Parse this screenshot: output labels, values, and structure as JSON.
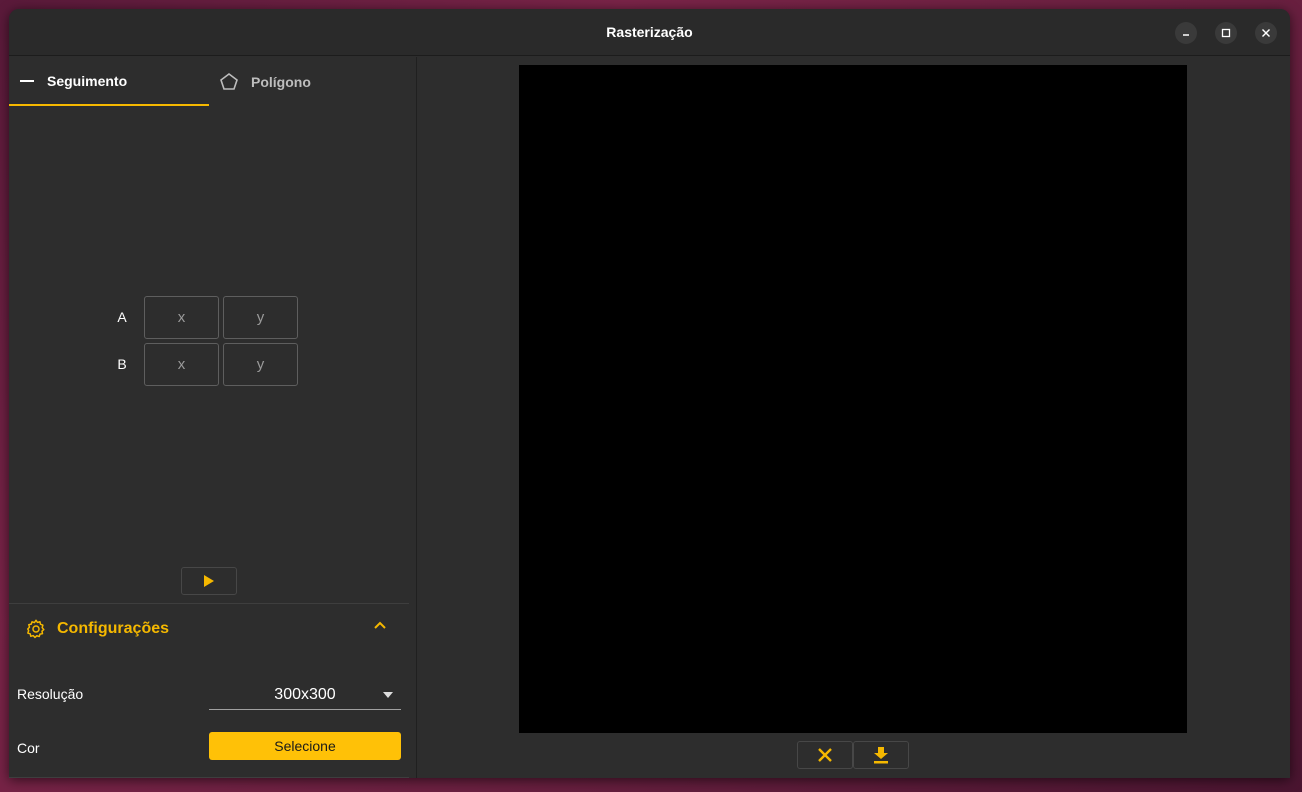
{
  "window": {
    "title": "Rasterização"
  },
  "tabs": [
    {
      "label": "Seguimento",
      "icon": "line-icon",
      "active": true
    },
    {
      "label": "Polígono",
      "icon": "pentagon-icon",
      "active": false
    }
  ],
  "points": [
    {
      "label": "A",
      "x_placeholder": "x",
      "y_placeholder": "y"
    },
    {
      "label": "B",
      "x_placeholder": "x",
      "y_placeholder": "y"
    }
  ],
  "config": {
    "title": "Configurações",
    "resolution_label": "Resolução",
    "resolution_value": "300x300",
    "color_label": "Cor",
    "color_button": "Selecione"
  },
  "colors": {
    "accent": "#f5b800",
    "canvas": "#000000",
    "window_bg": "#2d2d2d"
  },
  "icons": {
    "run": "play-icon",
    "clear": "close-x-icon",
    "download": "download-icon",
    "settings": "gear-icon",
    "collapse": "chevron-up-icon"
  }
}
